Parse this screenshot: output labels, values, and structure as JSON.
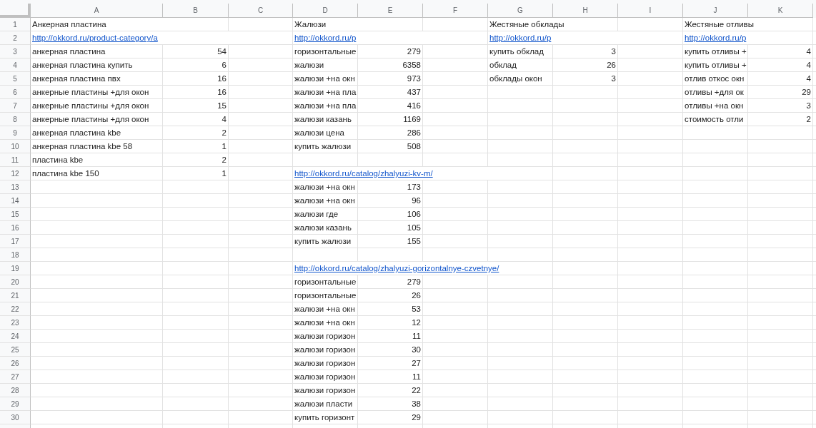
{
  "columns": [
    "A",
    "B",
    "C",
    "D",
    "E",
    "F",
    "G",
    "H",
    "I",
    "J",
    "K"
  ],
  "rows": [
    {
      "number": "1",
      "cells": [
        {
          "text": "Анкерная пластина",
          "kind": "text"
        },
        null,
        null,
        {
          "text": "Жалюзи",
          "kind": "text"
        },
        null,
        null,
        {
          "text": "Жестяные обклады",
          "kind": "text"
        },
        null,
        null,
        {
          "text": "Жестяные отливы",
          "kind": "text"
        },
        null
      ]
    },
    {
      "number": "2",
      "cells": [
        {
          "text": "http://okkord.ru/product-category/a",
          "kind": "link"
        },
        null,
        null,
        {
          "text": "http://okkord.ru/p",
          "kind": "link"
        },
        null,
        null,
        {
          "text": "http://okkord.ru/p",
          "kind": "link"
        },
        null,
        null,
        {
          "text": "http://okkord.ru/p",
          "kind": "link"
        },
        null
      ]
    },
    {
      "number": "3",
      "cells": [
        {
          "text": "анкерная пластина",
          "kind": "text"
        },
        {
          "text": "54",
          "kind": "number"
        },
        null,
        {
          "text": "горизонтальные",
          "kind": "text"
        },
        {
          "text": "279",
          "kind": "number"
        },
        null,
        {
          "text": "купить обклад",
          "kind": "text"
        },
        {
          "text": "3",
          "kind": "number"
        },
        null,
        {
          "text": "купить отливы +",
          "kind": "text"
        },
        {
          "text": "4",
          "kind": "number"
        }
      ]
    },
    {
      "number": "4",
      "cells": [
        {
          "text": "анкерная пластина купить",
          "kind": "text"
        },
        {
          "text": "6",
          "kind": "number"
        },
        null,
        {
          "text": "жалюзи",
          "kind": "text"
        },
        {
          "text": "6358",
          "kind": "number"
        },
        null,
        {
          "text": "обклад",
          "kind": "text"
        },
        {
          "text": "26",
          "kind": "number"
        },
        null,
        {
          "text": "купить отливы +",
          "kind": "text"
        },
        {
          "text": "4",
          "kind": "number"
        }
      ]
    },
    {
      "number": "5",
      "cells": [
        {
          "text": "анкерная пластина пвх",
          "kind": "text"
        },
        {
          "text": "16",
          "kind": "number"
        },
        null,
        {
          "text": "жалюзи +на окн",
          "kind": "text"
        },
        {
          "text": "973",
          "kind": "number"
        },
        null,
        {
          "text": "обклады окон",
          "kind": "text"
        },
        {
          "text": "3",
          "kind": "number"
        },
        null,
        {
          "text": "отлив откос окн",
          "kind": "text"
        },
        {
          "text": "4",
          "kind": "number"
        }
      ]
    },
    {
      "number": "6",
      "cells": [
        {
          "text": "анкерные пластины +для окон",
          "kind": "text"
        },
        {
          "text": "16",
          "kind": "number"
        },
        null,
        {
          "text": "жалюзи +на пла",
          "kind": "text"
        },
        {
          "text": "437",
          "kind": "number"
        },
        null,
        null,
        null,
        null,
        {
          "text": "отливы +для ок",
          "kind": "text"
        },
        {
          "text": "29",
          "kind": "number"
        }
      ]
    },
    {
      "number": "7",
      "cells": [
        {
          "text": "анкерные пластины +для окон",
          "kind": "text"
        },
        {
          "text": "15",
          "kind": "number"
        },
        null,
        {
          "text": "жалюзи +на пла",
          "kind": "text"
        },
        {
          "text": "416",
          "kind": "number"
        },
        null,
        null,
        null,
        null,
        {
          "text": "отливы +на окн",
          "kind": "text"
        },
        {
          "text": "3",
          "kind": "number"
        }
      ]
    },
    {
      "number": "8",
      "cells": [
        {
          "text": "анкерные пластины +для окон",
          "kind": "text"
        },
        {
          "text": "4",
          "kind": "number"
        },
        null,
        {
          "text": "жалюзи казань",
          "kind": "text"
        },
        {
          "text": "1169",
          "kind": "number"
        },
        null,
        null,
        null,
        null,
        {
          "text": "стоимость отли",
          "kind": "text"
        },
        {
          "text": "2",
          "kind": "number"
        }
      ]
    },
    {
      "number": "9",
      "cells": [
        {
          "text": "анкерная пластина kbe",
          "kind": "text"
        },
        {
          "text": "2",
          "kind": "number"
        },
        null,
        {
          "text": "жалюзи цена",
          "kind": "text"
        },
        {
          "text": "286",
          "kind": "number"
        },
        null,
        null,
        null,
        null,
        null,
        null
      ]
    },
    {
      "number": "10",
      "cells": [
        {
          "text": "анкерная пластина kbe 58",
          "kind": "text"
        },
        {
          "text": "1",
          "kind": "number"
        },
        null,
        {
          "text": "купить жалюзи",
          "kind": "text"
        },
        {
          "text": "508",
          "kind": "number"
        },
        null,
        null,
        null,
        null,
        null,
        null
      ]
    },
    {
      "number": "11",
      "cells": [
        {
          "text": "пластина kbe",
          "kind": "text"
        },
        {
          "text": "2",
          "kind": "number"
        },
        null,
        null,
        null,
        null,
        null,
        null,
        null,
        null,
        null
      ]
    },
    {
      "number": "12",
      "cells": [
        {
          "text": "пластина kbe 150",
          "kind": "text"
        },
        {
          "text": "1",
          "kind": "number"
        },
        null,
        {
          "text": "http://okkord.ru/catalog/zhalyuzi-kv-m/",
          "kind": "link"
        },
        null,
        null,
        null,
        null,
        null,
        null,
        null
      ]
    },
    {
      "number": "13",
      "cells": [
        null,
        null,
        null,
        {
          "text": "жалюзи +на окн",
          "kind": "text"
        },
        {
          "text": "173",
          "kind": "number"
        },
        null,
        null,
        null,
        null,
        null,
        null
      ]
    },
    {
      "number": "14",
      "cells": [
        null,
        null,
        null,
        {
          "text": "жалюзи +на окн",
          "kind": "text"
        },
        {
          "text": "96",
          "kind": "number"
        },
        null,
        null,
        null,
        null,
        null,
        null
      ]
    },
    {
      "number": "15",
      "cells": [
        null,
        null,
        null,
        {
          "text": "жалюзи где",
          "kind": "text"
        },
        {
          "text": "106",
          "kind": "number"
        },
        null,
        null,
        null,
        null,
        null,
        null
      ]
    },
    {
      "number": "16",
      "cells": [
        null,
        null,
        null,
        {
          "text": "жалюзи казань",
          "kind": "text"
        },
        {
          "text": "105",
          "kind": "number"
        },
        null,
        null,
        null,
        null,
        null,
        null
      ]
    },
    {
      "number": "17",
      "cells": [
        null,
        null,
        null,
        {
          "text": "купить жалюзи",
          "kind": "text"
        },
        {
          "text": "155",
          "kind": "number"
        },
        null,
        null,
        null,
        null,
        null,
        null
      ]
    },
    {
      "number": "18",
      "cells": [
        null,
        null,
        null,
        null,
        null,
        null,
        null,
        null,
        null,
        null,
        null
      ]
    },
    {
      "number": "19",
      "cells": [
        null,
        null,
        null,
        {
          "text": "http://okkord.ru/catalog/zhalyuzi-gorizontalnye-czvetnye/",
          "kind": "link"
        },
        null,
        null,
        null,
        null,
        null,
        null,
        null
      ]
    },
    {
      "number": "20",
      "cells": [
        null,
        null,
        null,
        {
          "text": "горизонтальные",
          "kind": "text"
        },
        {
          "text": "279",
          "kind": "number"
        },
        null,
        null,
        null,
        null,
        null,
        null
      ]
    },
    {
      "number": "21",
      "cells": [
        null,
        null,
        null,
        {
          "text": "горизонтальные",
          "kind": "text"
        },
        {
          "text": "26",
          "kind": "number"
        },
        null,
        null,
        null,
        null,
        null,
        null
      ]
    },
    {
      "number": "22",
      "cells": [
        null,
        null,
        null,
        {
          "text": "жалюзи +на окн",
          "kind": "text"
        },
        {
          "text": "53",
          "kind": "number"
        },
        null,
        null,
        null,
        null,
        null,
        null
      ]
    },
    {
      "number": "23",
      "cells": [
        null,
        null,
        null,
        {
          "text": "жалюзи +на окн",
          "kind": "text"
        },
        {
          "text": "12",
          "kind": "number"
        },
        null,
        null,
        null,
        null,
        null,
        null
      ]
    },
    {
      "number": "24",
      "cells": [
        null,
        null,
        null,
        {
          "text": "жалюзи горизон",
          "kind": "text"
        },
        {
          "text": "11",
          "kind": "number"
        },
        null,
        null,
        null,
        null,
        null,
        null
      ]
    },
    {
      "number": "25",
      "cells": [
        null,
        null,
        null,
        {
          "text": "жалюзи горизон",
          "kind": "text"
        },
        {
          "text": "30",
          "kind": "number"
        },
        null,
        null,
        null,
        null,
        null,
        null
      ]
    },
    {
      "number": "26",
      "cells": [
        null,
        null,
        null,
        {
          "text": "жалюзи горизон",
          "kind": "text"
        },
        {
          "text": "27",
          "kind": "number"
        },
        null,
        null,
        null,
        null,
        null,
        null
      ]
    },
    {
      "number": "27",
      "cells": [
        null,
        null,
        null,
        {
          "text": "жалюзи горизон",
          "kind": "text"
        },
        {
          "text": "11",
          "kind": "number"
        },
        null,
        null,
        null,
        null,
        null,
        null
      ]
    },
    {
      "number": "28",
      "cells": [
        null,
        null,
        null,
        {
          "text": "жалюзи горизон",
          "kind": "text"
        },
        {
          "text": "22",
          "kind": "number"
        },
        null,
        null,
        null,
        null,
        null,
        null
      ]
    },
    {
      "number": "29",
      "cells": [
        null,
        null,
        null,
        {
          "text": "жалюзи пласти",
          "kind": "text"
        },
        {
          "text": "38",
          "kind": "number"
        },
        null,
        null,
        null,
        null,
        null,
        null
      ]
    },
    {
      "number": "30",
      "cells": [
        null,
        null,
        null,
        {
          "text": "купить горизонт",
          "kind": "text"
        },
        {
          "text": "29",
          "kind": "number"
        },
        null,
        null,
        null,
        null,
        null,
        null
      ]
    }
  ]
}
